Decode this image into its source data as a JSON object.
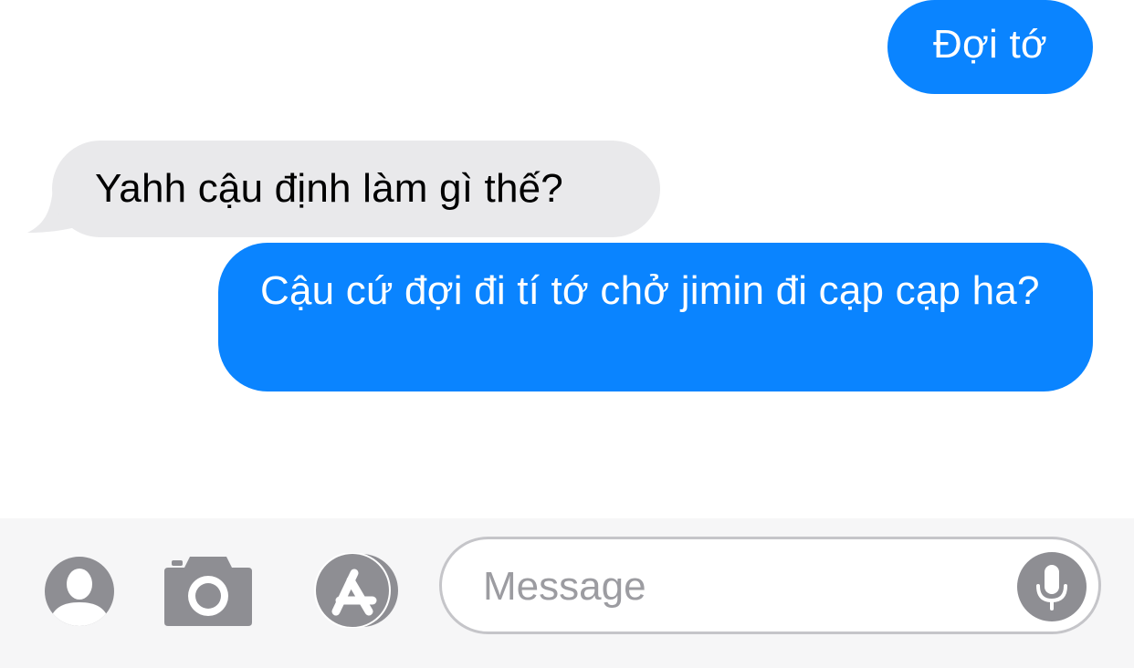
{
  "conversation": {
    "messages": [
      {
        "direction": "outgoing",
        "text": "Đợi tớ"
      },
      {
        "direction": "incoming",
        "text": "Yahh cậu định làm gì thế?"
      },
      {
        "direction": "outgoing",
        "text": "Cậu cứ đợi đi tí tớ chở jimin đi cạp cạp ha?"
      }
    ]
  },
  "composer": {
    "placeholder": "Message",
    "icons": {
      "contact": "contact-icon",
      "camera": "camera-icon",
      "appstore": "appstore-icon",
      "mic": "mic-icon"
    }
  },
  "colors": {
    "outgoing_bubble": "#0a84ff",
    "incoming_bubble": "#e9e9eb",
    "toolbar_bg": "#f6f6f7",
    "icon_gray": "#8e8e93"
  }
}
